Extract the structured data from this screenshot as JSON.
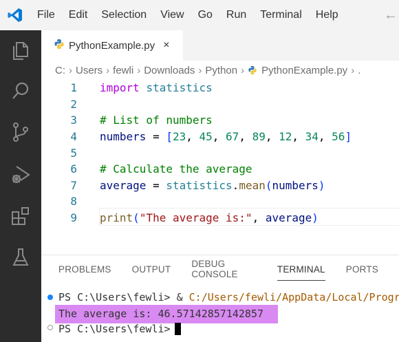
{
  "menubar": {
    "items": [
      "File",
      "Edit",
      "Selection",
      "View",
      "Go",
      "Run",
      "Terminal",
      "Help"
    ],
    "logo_icon": "vscode-logo-icon",
    "back_icon": "arrow-left-icon"
  },
  "activitybar": {
    "icons": [
      "explorer-icon",
      "search-icon",
      "source-control-icon",
      "run-debug-icon",
      "extensions-icon",
      "testing-icon"
    ]
  },
  "tabs": [
    {
      "label": "PythonExample.py",
      "icon": "python-file-icon",
      "active": true,
      "close_label": "×"
    }
  ],
  "breadcrumb": {
    "parts": [
      "C:",
      "Users",
      "fewli",
      "Downloads",
      "Python"
    ],
    "file": "PythonExample.py",
    "separator": "›",
    "tail": "."
  },
  "editor": {
    "lines": [
      {
        "n": "1",
        "tokens": [
          {
            "t": "import",
            "c": "kw2"
          },
          {
            "t": " ",
            "c": "plain"
          },
          {
            "t": "statistics",
            "c": "mod"
          }
        ]
      },
      {
        "n": "2",
        "tokens": []
      },
      {
        "n": "3",
        "tokens": [
          {
            "t": "# List of numbers",
            "c": "cmt"
          }
        ]
      },
      {
        "n": "4",
        "tokens": [
          {
            "t": "numbers",
            "c": "var"
          },
          {
            "t": " = ",
            "c": "plain"
          },
          {
            "t": "[",
            "c": "bracket"
          },
          {
            "t": "23",
            "c": "num"
          },
          {
            "t": ", ",
            "c": "plain"
          },
          {
            "t": "45",
            "c": "num"
          },
          {
            "t": ", ",
            "c": "plain"
          },
          {
            "t": "67",
            "c": "num"
          },
          {
            "t": ", ",
            "c": "plain"
          },
          {
            "t": "89",
            "c": "num"
          },
          {
            "t": ", ",
            "c": "plain"
          },
          {
            "t": "12",
            "c": "num"
          },
          {
            "t": ", ",
            "c": "plain"
          },
          {
            "t": "34",
            "c": "num"
          },
          {
            "t": ", ",
            "c": "plain"
          },
          {
            "t": "56",
            "c": "num"
          },
          {
            "t": "]",
            "c": "bracket"
          }
        ]
      },
      {
        "n": "5",
        "tokens": []
      },
      {
        "n": "6",
        "tokens": [
          {
            "t": "# Calculate the average",
            "c": "cmt"
          }
        ]
      },
      {
        "n": "7",
        "tokens": [
          {
            "t": "average",
            "c": "var"
          },
          {
            "t": " = ",
            "c": "plain"
          },
          {
            "t": "statistics",
            "c": "mod"
          },
          {
            "t": ".",
            "c": "plain"
          },
          {
            "t": "mean",
            "c": "fn"
          },
          {
            "t": "(",
            "c": "bracket"
          },
          {
            "t": "numbers",
            "c": "var"
          },
          {
            "t": ")",
            "c": "bracket"
          }
        ]
      },
      {
        "n": "8",
        "tokens": []
      },
      {
        "n": "9",
        "tokens": [
          {
            "t": "print",
            "c": "fn"
          },
          {
            "t": "(",
            "c": "bracket"
          },
          {
            "t": "\"The average is:\"",
            "c": "str"
          },
          {
            "t": ", ",
            "c": "plain"
          },
          {
            "t": "average",
            "c": "var"
          },
          {
            "t": ")",
            "c": "bracket"
          }
        ]
      }
    ]
  },
  "panel": {
    "tabs": [
      "PROBLEMS",
      "OUTPUT",
      "DEBUG CONSOLE",
      "TERMINAL",
      "PORTS"
    ],
    "active_tab": "TERMINAL"
  },
  "terminal": {
    "line1_prompt": "PS C:\\Users\\fewli> ",
    "line1_amp": "& ",
    "line1_path": "C:/Users/fewli/AppData/Local/Progr",
    "line2_output": "The average is: 46.57142857142857",
    "line3_prompt": "PS C:\\Users\\fewli>",
    "highlight_color": "#d98af2"
  }
}
